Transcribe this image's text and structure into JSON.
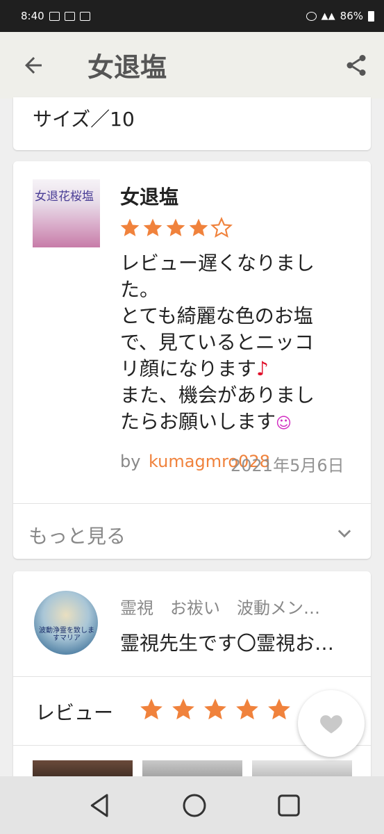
{
  "status_bar": {
    "time": "8:40",
    "battery_percent": "86%"
  },
  "app_bar": {
    "title": "女退塩"
  },
  "size_card": {
    "size_text": "サイズ／10"
  },
  "review_card": {
    "thumbnail_caption": "女退花桜塩",
    "product_name": "女退塩",
    "rating": 4,
    "rating_max": 5,
    "review_lines": [
      "レビュー遅くなりまし",
      "た。",
      "とても綺麗な色のお塩",
      "で、見ているとニッコ",
      "リ顔になります",
      "また、機会がありまし",
      "たらお願いします"
    ],
    "by_label": "by",
    "author": "kumagmro028",
    "date": "2021年5月6日",
    "more_label": "もっと見る"
  },
  "shop_card": {
    "avatar_caption": "波動浄霊を致しますマリア",
    "tags": "霊視　お祓い　波動メン…",
    "description": "霊視先生です〇霊視お…",
    "review_label": "レビュー",
    "rating": 5
  },
  "colors": {
    "accent": "#f0823c",
    "star": "#f0823c"
  },
  "icons": {
    "back": "back-arrow-icon",
    "share": "share-icon",
    "chevron": "chevron-down-icon",
    "favorite": "heart-icon"
  }
}
